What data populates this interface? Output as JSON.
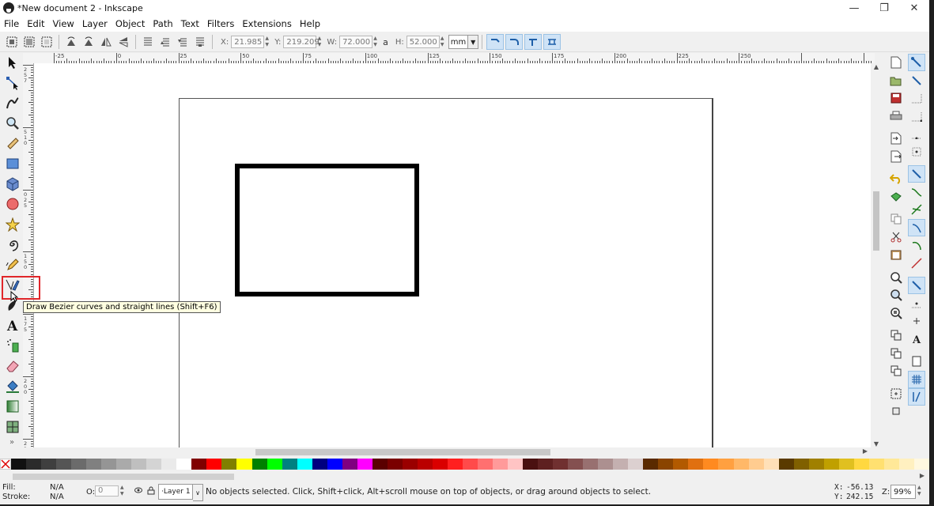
{
  "window": {
    "title": "*New document 2 - Inkscape",
    "minimize": "—",
    "maximize": "❐",
    "close": "✕"
  },
  "menu": [
    "File",
    "Edit",
    "View",
    "Layer",
    "Object",
    "Path",
    "Text",
    "Filters",
    "Extensions",
    "Help"
  ],
  "controls": {
    "x_label": "X:",
    "x_value": "21.985",
    "y_label": "Y:",
    "y_value": "219.209",
    "w_label": "W:",
    "w_value": "72.000",
    "lock_glyph": "a",
    "h_label": "H:",
    "h_value": "52.000",
    "unit": "mm"
  },
  "ruler": {
    "top_labels": [
      "-25",
      "0",
      "25",
      "50",
      "75",
      "100",
      "125",
      "150",
      "175",
      "200",
      "225",
      "250"
    ],
    "left_labels": [
      "2",
      "5",
      "7",
      "5",
      "1",
      "0",
      "0",
      "2",
      "5",
      "1",
      "5",
      "0",
      "1",
      "7",
      "5",
      "2",
      "0",
      "0",
      "2",
      "2",
      "5"
    ]
  },
  "tooltip": "Draw Bezier curves and straight lines (Shift+F6)",
  "toolbox_more": "»",
  "status": {
    "fill_label": "Fill:",
    "fill_value": "N/A",
    "stroke_label": "Stroke:",
    "stroke_value": "N/A",
    "opacity_label": "O:",
    "opacity_value": "0",
    "layer": "·Layer 1",
    "message": "No objects selected. Click, Shift+click, Alt+scroll mouse on top of objects, or drag around objects to select.",
    "x_label": "X:",
    "x_value": "-56.13",
    "y_label": "Y:",
    "y_value": "242.15",
    "zoom_label": "Z:",
    "zoom_value": "99%"
  },
  "palette": [
    "#111111",
    "#2b2b2b",
    "#3f3f3f",
    "#555555",
    "#6b6b6b",
    "#808080",
    "#959595",
    "#aaaaaa",
    "#bfbfbf",
    "#d4d4d4",
    "#eaeaea",
    "#ffffff",
    "#800000",
    "#ff0000",
    "#808000",
    "#ffff00",
    "#008000",
    "#00ff00",
    "#008080",
    "#00ffff",
    "#000080",
    "#0000ff",
    "#800080",
    "#ff00ff",
    "#5a0000",
    "#7a0000",
    "#9a0000",
    "#ba0000",
    "#da0000",
    "#ff1f1f",
    "#ff4a4a",
    "#ff7070",
    "#ff9a9a",
    "#ffc4c4",
    "#4a1010",
    "#5e2020",
    "#703030",
    "#845050",
    "#987070",
    "#ac9090",
    "#c4b0b0",
    "#dcd0d0",
    "#5a2a00",
    "#8a4400",
    "#b25a00",
    "#e07010",
    "#ff8a20",
    "#ffa040",
    "#ffb868",
    "#ffcc90",
    "#ffe0b8",
    "#5a3a00",
    "#806000",
    "#a08000",
    "#c0a000",
    "#e0c020",
    "#ffd840",
    "#ffe070",
    "#ffe898",
    "#fff0c0",
    "#fff8e0"
  ]
}
